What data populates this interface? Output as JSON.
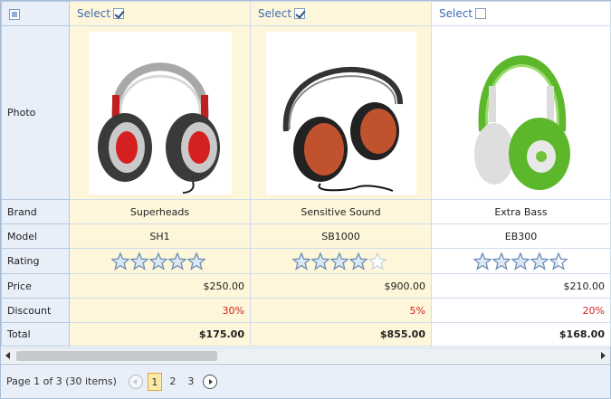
{
  "columns": [
    {
      "select_label": "Select",
      "checked": true,
      "brand": "Superheads",
      "model": "SH1",
      "rating": 5,
      "price": "$250.00",
      "discount": "30%",
      "total": "$175.00"
    },
    {
      "select_label": "Select",
      "checked": true,
      "brand": "Sensitive Sound",
      "model": "SB1000",
      "rating": 4,
      "price": "$900.00",
      "discount": "5%",
      "total": "$855.00"
    },
    {
      "select_label": "Select",
      "checked": false,
      "brand": "Extra Bass",
      "model": "EB300",
      "rating": 4.5,
      "price": "$210.00",
      "discount": "20%",
      "total": "$168.00"
    }
  ],
  "rows": {
    "photo": "Photo",
    "brand": "Brand",
    "model": "Model",
    "rating": "Rating",
    "price": "Price",
    "discount": "Discount",
    "total": "Total"
  },
  "pager": {
    "summary": "Page 1 of 3 (30 items)",
    "pages": [
      "1",
      "2",
      "3"
    ],
    "current": "1"
  },
  "colors": {
    "selected_bg": "#fdf6da",
    "header_bg": "#e8eff8",
    "discount": "#d52020",
    "accent": "#3d6eb2"
  }
}
